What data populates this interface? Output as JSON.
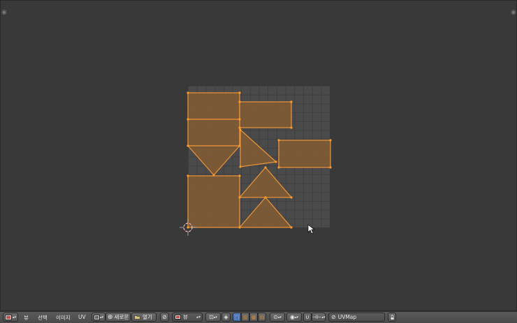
{
  "header": {
    "menus": [
      "뷰",
      "선택",
      "이미지",
      "UV"
    ],
    "image_new_label": "새로운",
    "image_open_label": "열기",
    "view_mode_value": "뷰",
    "uv_map_value": "UVMap"
  },
  "colors": {
    "face_fill": "#7e5a34",
    "edge": "#e8923a",
    "vertex": "#ff9a2a"
  }
}
